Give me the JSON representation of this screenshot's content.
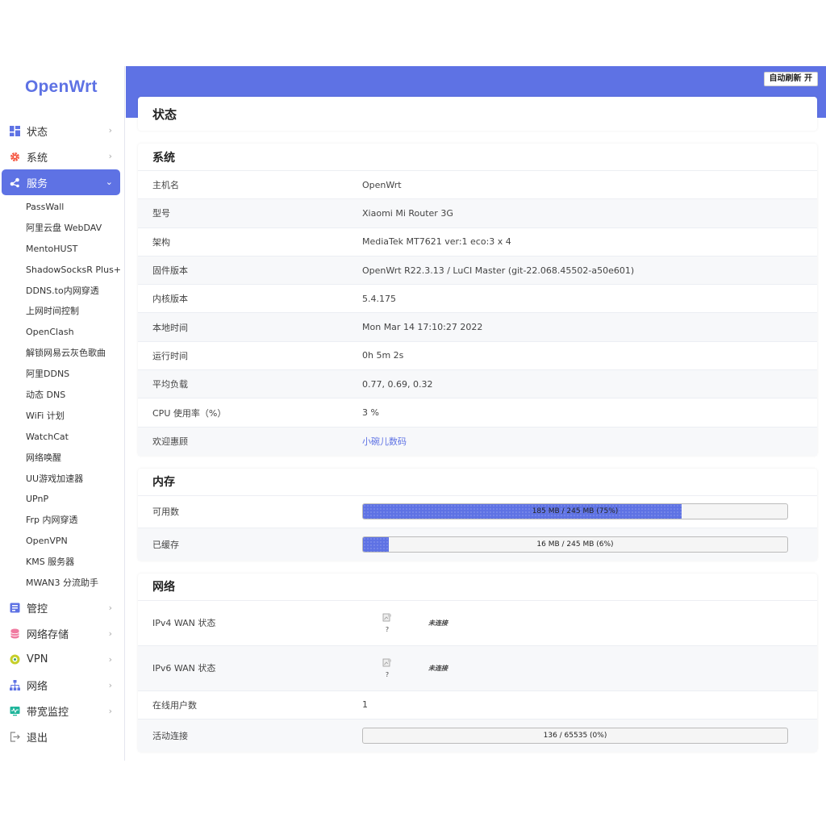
{
  "app": {
    "logo": "OpenWrt"
  },
  "header": {
    "refresh_label": "自动刷新 开"
  },
  "sidebar": {
    "items": [
      {
        "label": "状态",
        "icon": "dashboard-icon"
      },
      {
        "label": "系统",
        "icon": "gear-icon"
      },
      {
        "label": "服务",
        "icon": "share-icon",
        "active": true
      },
      {
        "label": "管控",
        "icon": "control-icon"
      },
      {
        "label": "网络存储",
        "icon": "database-icon"
      },
      {
        "label": "VPN",
        "icon": "vpn-icon"
      },
      {
        "label": "网络",
        "icon": "network-icon"
      },
      {
        "label": "带宽监控",
        "icon": "monitor-icon"
      },
      {
        "label": "退出",
        "icon": "logout-icon"
      }
    ],
    "services": [
      "PassWall",
      "阿里云盘 WebDAV",
      "MentoHUST",
      "ShadowSocksR Plus+",
      "DDNS.to内网穿透",
      "上网时间控制",
      "OpenClash",
      "解锁网易云灰色歌曲",
      "阿里DDNS",
      "动态 DNS",
      "WiFi 计划",
      "WatchCat",
      "网络唤醒",
      "UU游戏加速器",
      "UPnP",
      "Frp 内网穿透",
      "OpenVPN",
      "KMS 服务器",
      "MWAN3 分流助手"
    ]
  },
  "page": {
    "title": "状态"
  },
  "system": {
    "title": "系统",
    "rows": [
      {
        "key": "主机名",
        "value": "OpenWrt"
      },
      {
        "key": "型号",
        "value": "Xiaomi Mi Router 3G"
      },
      {
        "key": "架构",
        "value": "MediaTek MT7621 ver:1 eco:3 x 4"
      },
      {
        "key": "固件版本",
        "value": "OpenWrt R22.3.13 / LuCI Master (git-22.068.45502-a50e601)"
      },
      {
        "key": "内核版本",
        "value": "5.4.175"
      },
      {
        "key": "本地时间",
        "value": "Mon Mar 14 17:10:27 2022"
      },
      {
        "key": "运行时间",
        "value": "0h 5m 2s"
      },
      {
        "key": "平均负载",
        "value": "0.77, 0.69, 0.32"
      },
      {
        "key": "CPU 使用率（%）",
        "value": "3 %"
      },
      {
        "key": "欢迎惠顾",
        "value": "小碗儿数码"
      }
    ]
  },
  "memory": {
    "title": "内存",
    "rows": [
      {
        "key": "可用数",
        "label": "185 MB / 245 MB (75%)",
        "percent": 75
      },
      {
        "key": "已缓存",
        "label": "16 MB / 245 MB (6%)",
        "percent": 6
      }
    ]
  },
  "network": {
    "title": "网络",
    "ipv4": {
      "key": "IPv4 WAN 状态",
      "icon_caption": "?",
      "status": "未连接"
    },
    "ipv6": {
      "key": "IPv6 WAN 状态",
      "icon_caption": "?",
      "status": "未连接"
    },
    "users": {
      "key": "在线用户数",
      "value": "1"
    },
    "conns": {
      "key": "活动连接",
      "label": "136 / 65535 (0%)",
      "percent": 0
    }
  },
  "colors": {
    "accent": "#5e72e4"
  }
}
